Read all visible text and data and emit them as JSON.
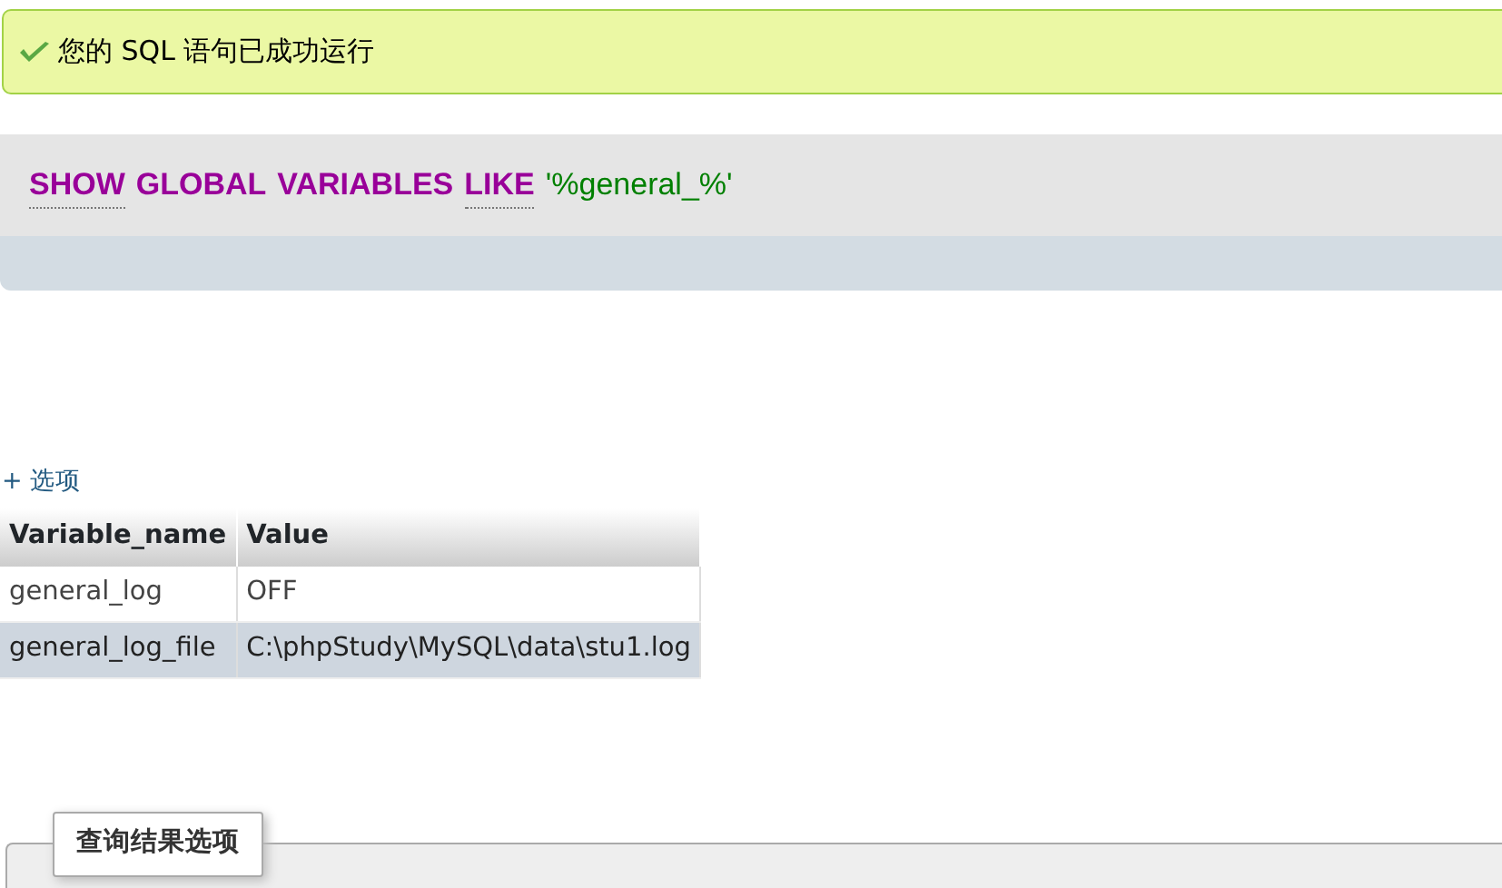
{
  "message": {
    "kind": "success",
    "text": "您的 SQL 语句已成功运行"
  },
  "query": {
    "tokens": [
      {
        "kind": "keyword",
        "text": "SHOW",
        "documented": true
      },
      {
        "kind": "keyword",
        "text": "GLOBAL",
        "documented": false
      },
      {
        "kind": "keyword",
        "text": "VARIABLES",
        "documented": false
      },
      {
        "kind": "keyword",
        "text": "LIKE",
        "documented": true
      },
      {
        "kind": "string",
        "text": "'%general_%'",
        "documented": false
      }
    ]
  },
  "options_link": {
    "icon": "+",
    "label": "选项"
  },
  "table": {
    "columns": [
      "Variable_name",
      "Value"
    ],
    "rows": [
      {
        "cells": [
          "general_log",
          "OFF"
        ],
        "selected": false
      },
      {
        "cells": [
          "general_log_file",
          "C:\\phpStudy\\MySQL\\data\\stu1.log"
        ],
        "selected": true
      }
    ]
  },
  "result_options": {
    "legend": "查询结果选项"
  }
}
